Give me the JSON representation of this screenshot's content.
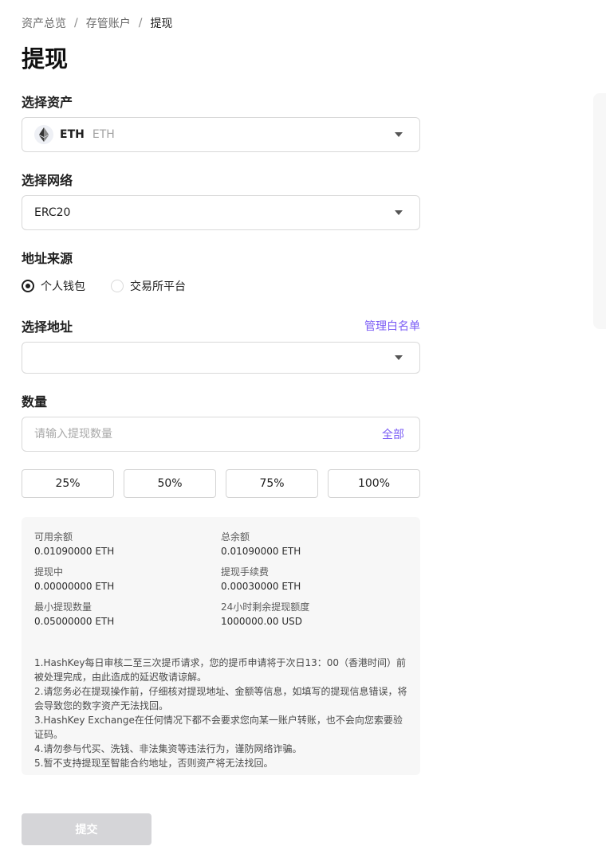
{
  "breadcrumb": {
    "items": [
      "资产总览",
      "存管账户",
      "提现"
    ],
    "separator": "/"
  },
  "page_title": "提现",
  "asset": {
    "label": "选择资产",
    "symbol": "ETH",
    "name": "ETH",
    "icon": "eth-icon"
  },
  "network": {
    "label": "选择网络",
    "value": "ERC20"
  },
  "address_source": {
    "label": "地址来源",
    "options": [
      {
        "label": "个人钱包",
        "checked": true
      },
      {
        "label": "交易所平台",
        "checked": false
      }
    ]
  },
  "address": {
    "label": "选择地址",
    "manage_link": "管理白名单",
    "value": ""
  },
  "amount": {
    "label": "数量",
    "placeholder": "请输入提现数量",
    "all_label": "全部",
    "percent_buttons": [
      "25%",
      "50%",
      "75%",
      "100%"
    ]
  },
  "info": {
    "items": [
      {
        "key": "可用余额",
        "value": "0.01090000 ETH"
      },
      {
        "key": "总余额",
        "value": "0.01090000 ETH"
      },
      {
        "key": "提现中",
        "value": "0.00000000 ETH"
      },
      {
        "key": "提现手续费",
        "value": "0.00030000 ETH"
      },
      {
        "key": "最小提现数量",
        "value": "0.05000000 ETH"
      },
      {
        "key": "24小时剩余提现额度",
        "value": "1000000.00 USD"
      }
    ],
    "notes": [
      "1.HashKey每日审核二至三次提币请求，您的提币申请将于次日13：00（香港时间）前被处理完成，由此造成的延迟敬请谅解。",
      "2.请您务必在提现操作前，仔细核对提现地址、金额等信息，如填写的提现信息错误，将会导致您的数字资产无法找回。",
      "3.HashKey Exchange在任何情况下都不会要求您向某一账户转账，也不会向您索要验证码。",
      "4.请勿参与代买、洗钱、非法集资等违法行为，谨防网络诈骗。",
      "5.暂不支持提现至智能合约地址，否则资产将无法找回。"
    ]
  },
  "submit_label": "提交",
  "colors": {
    "accent": "#7b5cf5",
    "disabled_button": "#d5d5d8",
    "panel_bg": "#f7f7f7"
  }
}
